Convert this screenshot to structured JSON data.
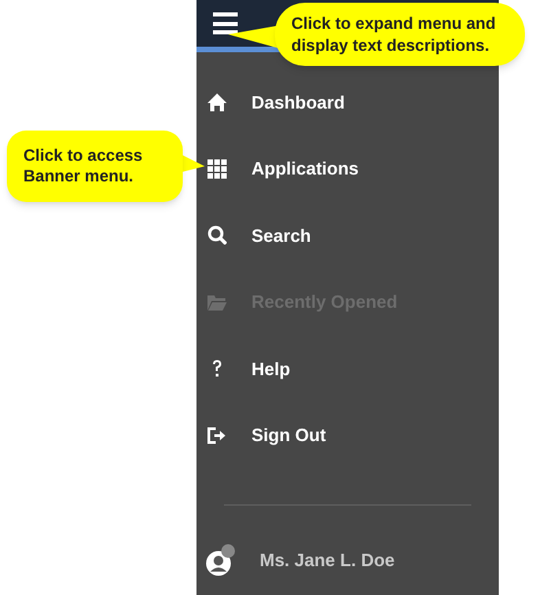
{
  "callouts": [
    {
      "text": "Click to expand menu and display text descriptions."
    },
    {
      "text": "Click to access Banner menu."
    }
  ],
  "menu": [
    {
      "label": "Dashboard",
      "kind": "home",
      "disabled": false
    },
    {
      "label": "Applications",
      "kind": "grid",
      "disabled": false
    },
    {
      "label": "Search",
      "kind": "search",
      "disabled": false
    },
    {
      "label": "Recently Opened",
      "kind": "folder",
      "disabled": true
    },
    {
      "label": "Help",
      "kind": "help",
      "disabled": false
    },
    {
      "label": "Sign Out",
      "kind": "signout",
      "disabled": false
    }
  ],
  "user": {
    "name": "Ms. Jane L. Doe"
  }
}
